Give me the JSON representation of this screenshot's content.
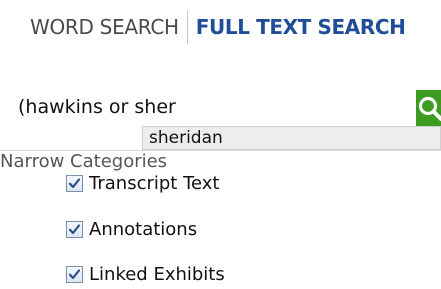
{
  "tabs": {
    "word_search": "WORD SEARCH",
    "full_text_search": "FULL TEXT SEARCH"
  },
  "search": {
    "value": "(hawkins or sher",
    "button_icon": "search-icon",
    "button_color": "#3d9b1f"
  },
  "suggestions": [
    "sheridan"
  ],
  "categories": {
    "title": "Narrow Categories",
    "items": [
      {
        "label": "Transcript Text",
        "checked": true
      },
      {
        "label": "Annotations",
        "checked": true
      },
      {
        "label": "Linked Exhibits",
        "checked": true
      }
    ]
  },
  "colors": {
    "active_tab": "#1f4e96",
    "inactive_tab": "#4a4a4a",
    "checkmark": "#2a4f86"
  }
}
